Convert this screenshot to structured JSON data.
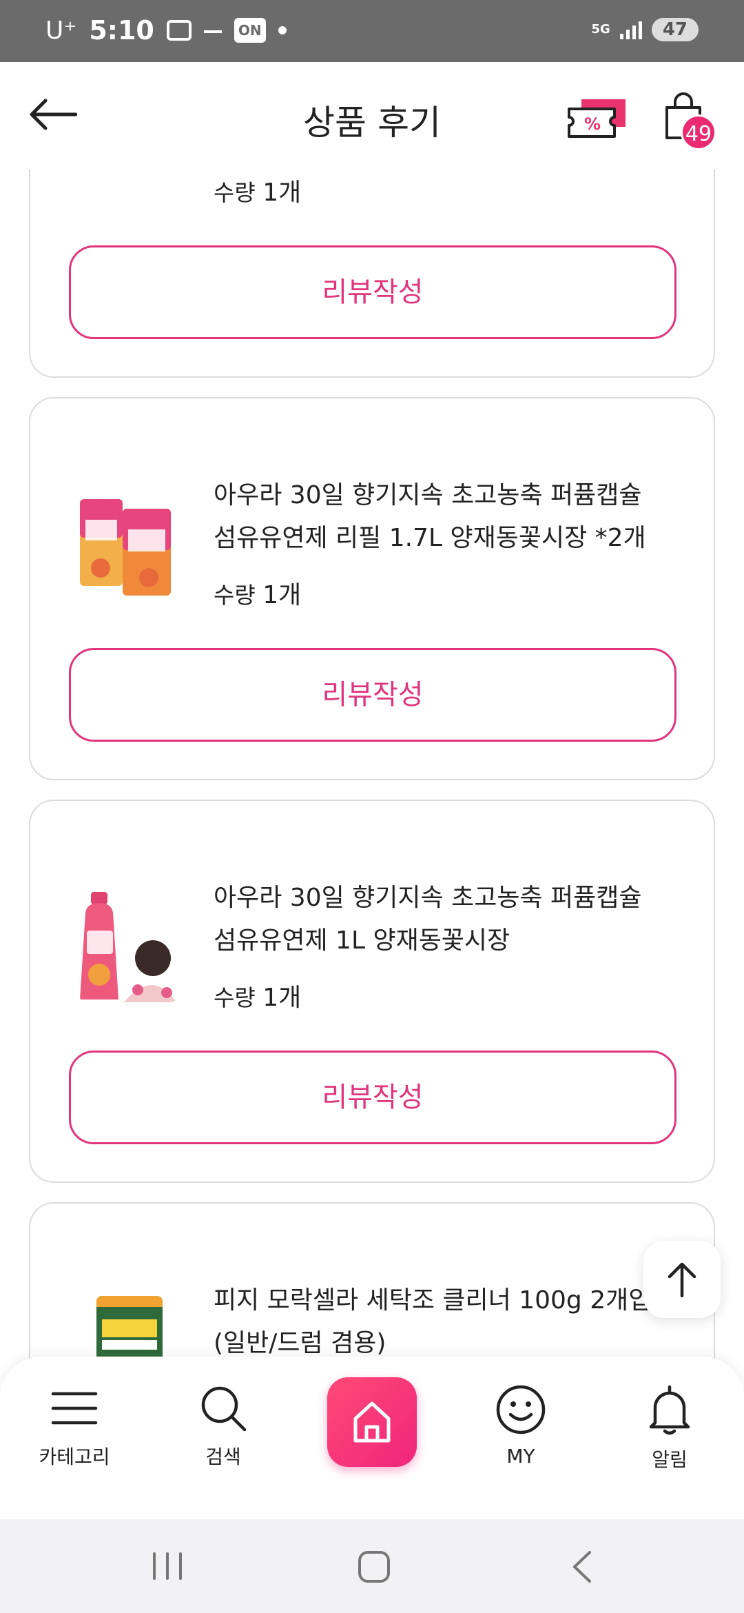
{
  "status_bar": {
    "carrier": "U⁺",
    "time": "5:10",
    "on_badge": "ON",
    "network": "5G",
    "battery": "47"
  },
  "header": {
    "title": "상품 후기",
    "cart_count": "49"
  },
  "cards": [
    {
      "quantity_label": "수량",
      "quantity_value": "1개",
      "review_button": "리뷰작성"
    },
    {
      "title_line1": "아우라 30일 향기지속 초고농축 퍼퓸캡슐",
      "title_line2": "섬유유연제 리필 1.7L  양재동꽃시장 *2개",
      "quantity_label": "수량",
      "quantity_value": "1개",
      "review_button": "리뷰작성"
    },
    {
      "title_line1": "아우라 30일 향기지속 초고농축 퍼퓸캡슐",
      "title_line2": "섬유유연제 1L  양재동꽃시장",
      "quantity_label": "수량",
      "quantity_value": "1개",
      "review_button": "리뷰작성"
    },
    {
      "title_line1": "피지 모락셀라 세탁조 클리너 100g 2개입",
      "title_line2": "(일반/드럼 겸용)"
    }
  ],
  "bottom_nav": {
    "category": "카테고리",
    "search": "검색",
    "my": "MY",
    "alarm": "알림"
  },
  "colors": {
    "accent": "#e0357b",
    "badge": "#ec2a72",
    "home_gradient_start": "#ff4a76",
    "home_gradient_end": "#f0257c"
  }
}
